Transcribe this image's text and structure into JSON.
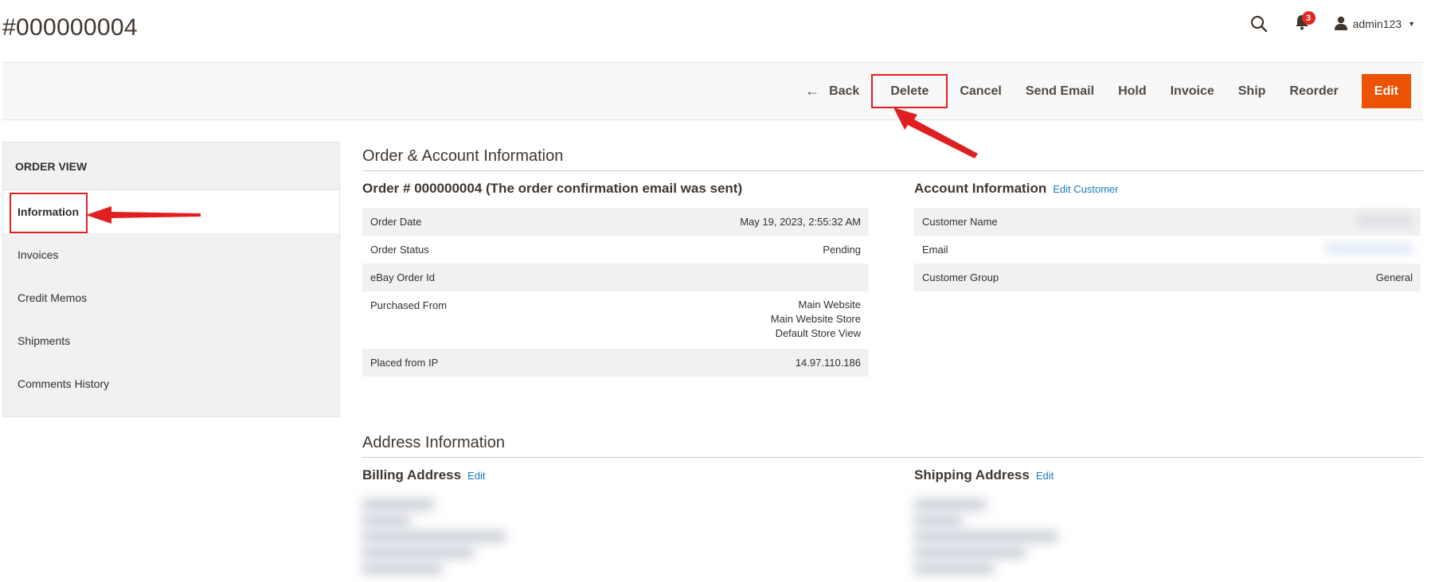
{
  "header": {
    "title": "#000000004",
    "notifications_count": "3",
    "user_name": "admin123",
    "icons": [
      "search-icon",
      "bell-icon",
      "user-icon",
      "caret-down-icon"
    ]
  },
  "actions": {
    "back": "Back",
    "delete": "Delete",
    "cancel": "Cancel",
    "send_email": "Send Email",
    "hold": "Hold",
    "invoice": "Invoice",
    "ship": "Ship",
    "reorder": "Reorder",
    "edit": "Edit"
  },
  "sidebar": {
    "title": "ORDER VIEW",
    "items": [
      {
        "label": "Information",
        "active": true
      },
      {
        "label": "Invoices"
      },
      {
        "label": "Credit Memos"
      },
      {
        "label": "Shipments"
      },
      {
        "label": "Comments History"
      }
    ]
  },
  "order_account": {
    "section_title": "Order & Account Information",
    "order_title": "Order # 000000004 (The order confirmation email was sent)",
    "order_rows": [
      {
        "label": "Order Date",
        "value": "May 19, 2023, 2:55:32 AM"
      },
      {
        "label": "Order Status",
        "value": "Pending"
      },
      {
        "label": "eBay Order Id",
        "value": ""
      },
      {
        "label": "Purchased From",
        "lines": [
          "Main Website",
          "Main Website Store",
          "Default Store View"
        ]
      },
      {
        "label": "Placed from IP",
        "value": "14.97.110.186"
      }
    ],
    "account_title": "Account Information",
    "edit_customer": "Edit Customer",
    "account_rows": [
      {
        "label": "Customer Name",
        "value": ""
      },
      {
        "label": "Email",
        "value": ""
      },
      {
        "label": "Customer Group",
        "value": "General"
      }
    ]
  },
  "address": {
    "section_title": "Address Information",
    "billing_title": "Billing Address",
    "billing_edit": "Edit",
    "shipping_title": "Shipping Address",
    "shipping_edit": "Edit"
  },
  "annotation_color": "#e02020",
  "accent_color": "#eb5202",
  "link_color": "#1979c3"
}
